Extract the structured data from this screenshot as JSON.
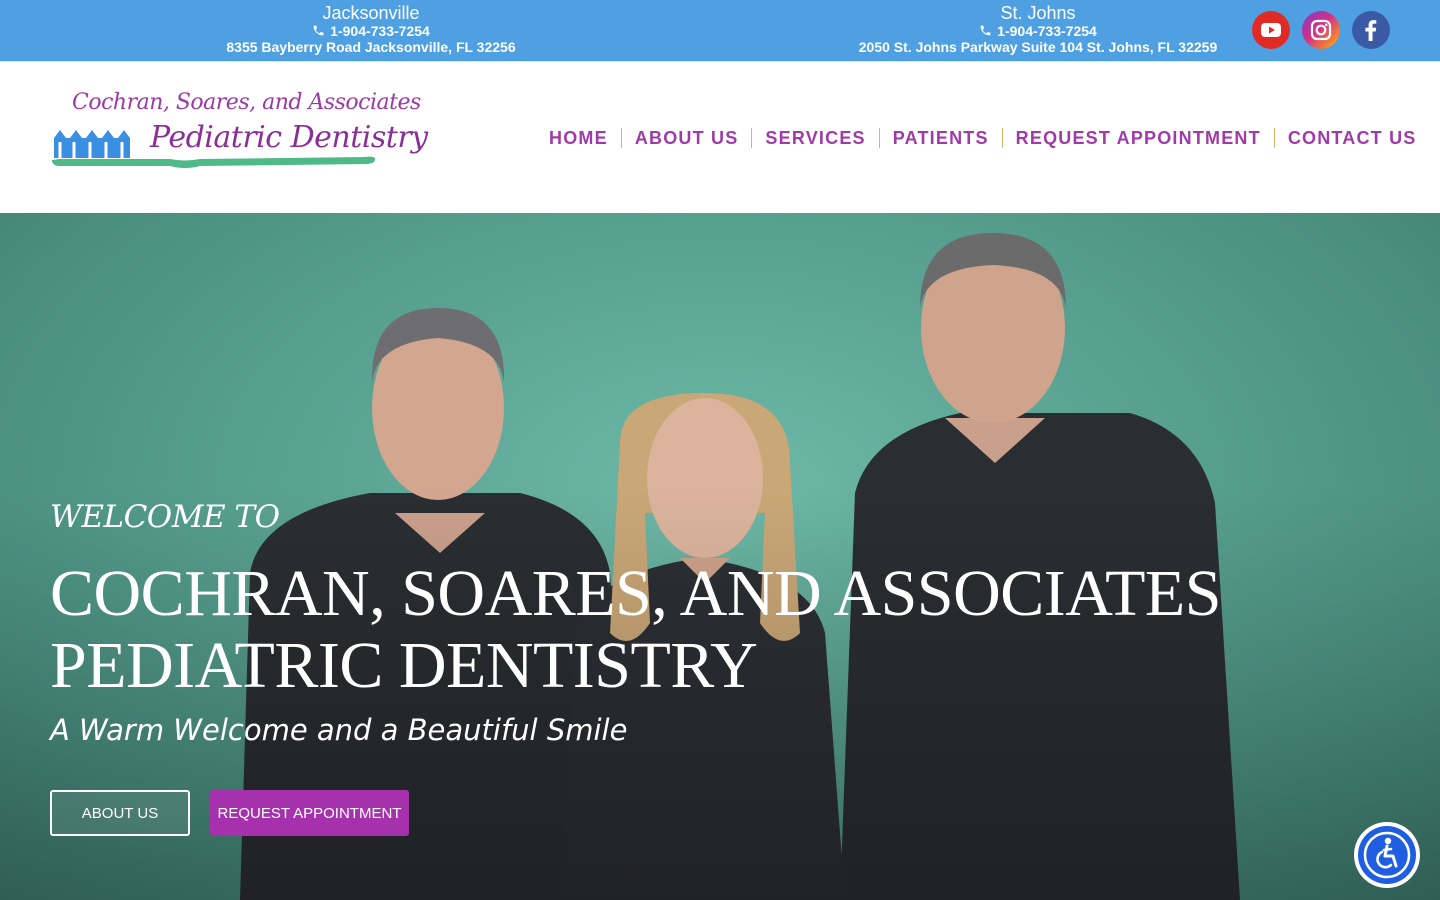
{
  "topbar": {
    "locations": [
      {
        "city": "Jacksonville",
        "phone": "1-904-733-7254",
        "address": "8355 Bayberry Road Jacksonville, FL 32256"
      },
      {
        "city": "St. Johns",
        "phone": "1-904-733-7254",
        "address": "2050 St. Johns Parkway Suite 104 St. Johns, FL 32259"
      }
    ],
    "social": [
      "youtube-icon",
      "instagram-icon",
      "facebook-icon"
    ]
  },
  "logo": {
    "line1": "Cochran, Soares, and Associates",
    "line2": "Pediatric Dentistry"
  },
  "nav": {
    "items": [
      {
        "label": "HOME"
      },
      {
        "label": "ABOUT US"
      },
      {
        "label": "SERVICES"
      },
      {
        "label": "PATIENTS"
      },
      {
        "label": "REQUEST APPOINTMENT"
      },
      {
        "label": "CONTACT US"
      }
    ]
  },
  "hero": {
    "welcome": "WELCOME TO",
    "title": "COCHRAN, SOARES, AND ASSOCIATES PEDIATRIC DENTISTRY",
    "tagline": "A Warm Welcome and a Beautiful Smile",
    "buttons": {
      "about": "ABOUT US",
      "request": "REQUEST APPOINTMENT"
    }
  },
  "colors": {
    "topbar": "#4f9fe3",
    "brand_purple": "#a03aa8",
    "button_purple": "#a531ad",
    "hero_teal": "#5aa392",
    "accessibility_blue": "#1f5ee0"
  },
  "accessibility": {
    "icon": "accessibility-icon"
  }
}
